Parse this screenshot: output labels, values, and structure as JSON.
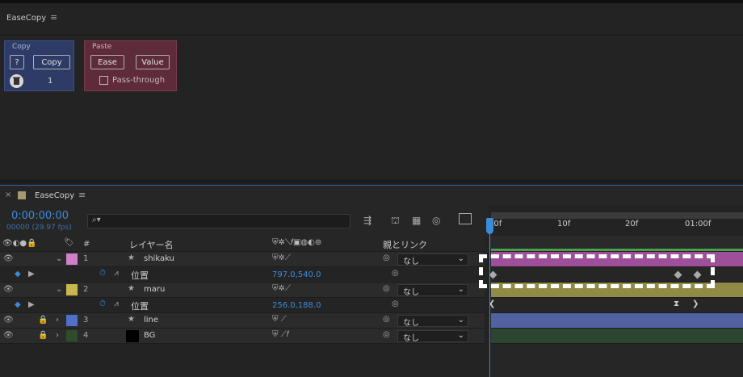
{
  "script_panel": {
    "title": "EaseCopy",
    "copy_group": {
      "title": "Copy",
      "help_label": "?",
      "copy_label": "Copy",
      "count": "1"
    },
    "paste_group": {
      "title": "Paste",
      "ease_label": "Ease",
      "value_label": "Value",
      "pass_through_label": "Pass-through",
      "pass_through_checked": false
    }
  },
  "timeline": {
    "tab_title": "EaseCopy",
    "timecode": "0:00:00:00",
    "fps_readout": "00000 (29.97 fps)",
    "search_placeholder": "",
    "columns": {
      "number": "#",
      "layer_name": "レイヤー名",
      "parent_link": "親とリンク"
    },
    "ruler_labels": [
      "00f",
      "10f",
      "20f",
      "01:00f"
    ],
    "layers": [
      {
        "num": "1",
        "name": "shikaku",
        "label_color": "#d17fc8",
        "parent": "なし"
      },
      {
        "num": "2",
        "name": "maru",
        "label_color": "#c9b74e",
        "parent": "なし"
      },
      {
        "num": "3",
        "name": "line",
        "label_color": "#4f6fc9",
        "parent": "なし"
      },
      {
        "num": "4",
        "name": "BG",
        "label_color": "#2e4d2c",
        "parent": "なし"
      }
    ],
    "properties": [
      {
        "name": "位置",
        "value": "797.0,540.0"
      },
      {
        "name": "位置",
        "value": "256.0,188.0"
      }
    ],
    "track_colors": [
      "#9d4f9a",
      "#8f8a45",
      "#5261a0",
      "#2d4530"
    ]
  }
}
